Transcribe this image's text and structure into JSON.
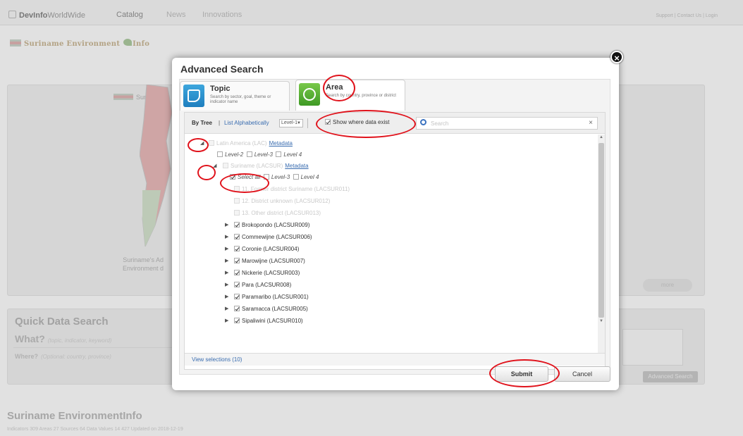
{
  "nav": {
    "brand_bold": "DevInfo",
    "brand_rest": "WorldWide",
    "links": [
      "Catalog",
      "News",
      "Innovations"
    ],
    "top_right": "Support | Contact Us | Login"
  },
  "site": {
    "logo_text": "Suriname Environment",
    "logo_suffix": "Info",
    "map_title": "Suriname",
    "map_caption_1": "Suriname's Ad",
    "map_caption_2": "Environment d",
    "pill_button": "more"
  },
  "quick_search": {
    "title": "Quick Data Search",
    "what_label": "What?",
    "what_hint": "(topic, indicator, keyword)",
    "where_label": "Where?",
    "where_hint": "(Optional: country, province)",
    "advanced_button": "Advanced Search"
  },
  "footer": {
    "title": "Suriname EnvironmentInfo",
    "stats": "Indicators 309 Areas 27 Sources 64 Data Values 14 427 Updated on 2018-12-19"
  },
  "modal": {
    "title": "Advanced Search",
    "tabs": [
      {
        "name": "Topic",
        "desc": "Search by sector, goal, theme or indicator name"
      },
      {
        "name": "Area",
        "desc": "Search by country, province or district"
      }
    ],
    "toolbar": {
      "by_tree": "By Tree",
      "separator": "|",
      "list_alpha": "List Alphabetically",
      "level_value": "Level-1",
      "show_label": "Show where data exist",
      "search_placeholder": "Search",
      "clear": "×"
    },
    "tree": {
      "root": {
        "label": "Latin America (LAC)",
        "metadata": "Metadata"
      },
      "root_levels": [
        "Level-2",
        "Level-3",
        "Level 4"
      ],
      "country": {
        "label": "Suriname (LACSUR)",
        "metadata": "Metadata"
      },
      "country_levels": [
        "Select all",
        "Level-3",
        "Level 4"
      ],
      "disabled_items": [
        "11. Former district Suriname (LACSUR011)",
        "12. District unknown (LACSUR012)",
        "13. Other district (LACSUR013)"
      ],
      "districts": [
        "Brokopondo (LACSUR009)",
        "Commewijne (LACSUR006)",
        "Coronie (LACSUR004)",
        "Marowijne (LACSUR007)",
        "Nickerie (LACSUR003)",
        "Para (LACSUR008)",
        "Paramaribo (LACSUR001)",
        "Saramacca (LACSUR005)",
        "Sipaliwini (LACSUR010)"
      ]
    },
    "view_selections": "View selections (10)",
    "submit": "Submit",
    "cancel": "Cancel",
    "close": "×"
  },
  "colors": {
    "annotation": "#e0121b",
    "link": "#3a6db0",
    "topic_icon": "#1f7fbf",
    "area_icon": "#3e9a24"
  }
}
